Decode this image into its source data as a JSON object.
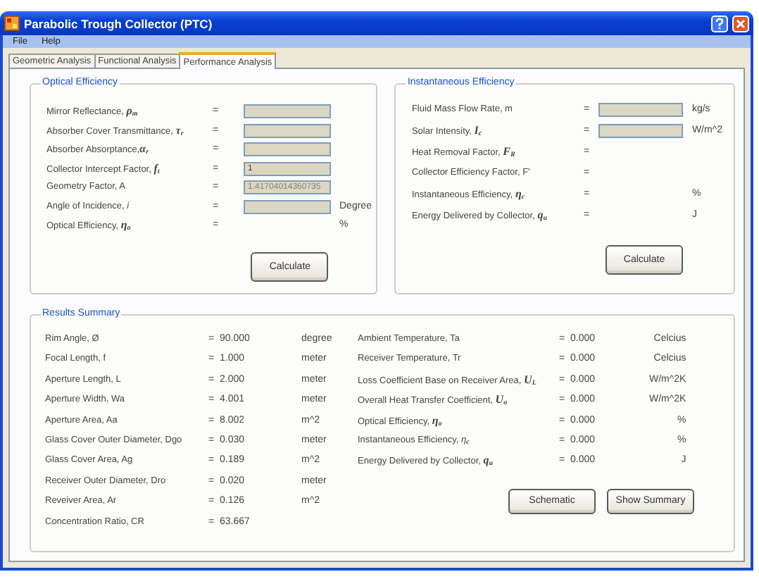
{
  "window": {
    "title": "Parabolic Trough Collector (PTC)"
  },
  "menu": [
    "File",
    "Help"
  ],
  "tabs": [
    {
      "label": "Geometric Analysis",
      "selected": false
    },
    {
      "label": "Functional Analysis",
      "selected": false
    },
    {
      "label": "Performance Analysis",
      "selected": true
    }
  ],
  "optical_efficiency": {
    "title": "Optical Efficiency",
    "button": "Calculate",
    "rows": [
      {
        "kind": "input",
        "label": "Mirror Reflectance, **ρ**$_{m}$",
        "sign": "="
      },
      {
        "kind": "input",
        "label": "Absorber Cover Transmittance, **τ**$_{r}$",
        "sign": "="
      },
      {
        "kind": "input",
        "label": "Absorber Absorptance,**α**$_{r}$",
        "sign": "="
      },
      {
        "kind": "input",
        "label": "Collector Intercept Factor, **f**$_{t}$",
        "sign": "=",
        "value": "1"
      },
      {
        "kind": "input",
        "label": "Geometry Factor, A",
        "sign": "=",
        "value": "1.41704014360735",
        "readonly": true
      },
      {
        "kind": "input",
        "label": "Angle of Incidence, *i*",
        "sign": "=",
        "unit": "Degree"
      },
      {
        "kind": "output",
        "label": "Optical Efficiency, **η**$_{o}$",
        "sign": "=",
        "unit": "%"
      }
    ]
  },
  "instantaneous_efficiency": {
    "title": "Instantaneous Efficiency",
    "button": "Calculate",
    "rows": [
      {
        "kind": "input",
        "label": "Fluid Mass Flow Rate, m",
        "sign": "=",
        "unit": "kg/s"
      },
      {
        "kind": "input",
        "label": "Solar Intensity, **I**$_{c}$",
        "sign": "=",
        "unit": "W/m^2"
      },
      {
        "kind": "output",
        "label": "Heat Removal Factor, **F**$_{R}$",
        "sign": "="
      },
      {
        "kind": "output",
        "label": "Collector Efficiency Factor, F'",
        "sign": "="
      },
      {
        "kind": "output",
        "label": "Instantaneous Efficiency, **η**$_{c}$",
        "sign": "=",
        "unit": "%"
      },
      {
        "kind": "output",
        "label": "Energy Delivered by Collector, **q**$_{u}$",
        "sign": "=",
        "unit": "J"
      }
    ]
  },
  "results_summary": {
    "title": "Results Summary",
    "buttons": [
      "Schematic",
      "Show Summary"
    ],
    "left_rows": [
      {
        "label": "Rim Angle, Ø",
        "sign": "=",
        "value": "90.000",
        "unit": "degree"
      },
      {
        "label": "Focal Length, f",
        "sign": "=",
        "value": "1.000",
        "unit": "meter"
      },
      {
        "label": "Aperture Length, L",
        "sign": "=",
        "value": "2.000",
        "unit": "meter"
      },
      {
        "label": "Aperture Width, Wa",
        "sign": "=",
        "value": "4.001",
        "unit": "meter"
      },
      {
        "label": "Aperture Area, Aa",
        "sign": "=",
        "value": "8.002",
        "unit": "m^2"
      },
      {
        "label": "Glass Cover Outer Diameter, Dgo",
        "sign": "=",
        "value": "0.030",
        "unit": "meter"
      },
      {
        "label": "Glass Cover Area, Ag",
        "sign": "=",
        "value": "0.189",
        "unit": "m^2"
      },
      {
        "label": "Receiver Outer Diameter, Dro",
        "sign": "=",
        "value": "0.020",
        "unit": "meter"
      },
      {
        "label": "Reveiver Area, Ar",
        "sign": "=",
        "value": "0.126",
        "unit": "m^2"
      },
      {
        "label": "Concentration Ratio, CR",
        "sign": "=",
        "value": "63.667"
      }
    ],
    "right_rows": [
      {
        "label": "Ambient Temperature, Ta",
        "sign": "=",
        "value": "0.000",
        "unit": "Celcius"
      },
      {
        "label": "Receiver Temperature, Tr",
        "sign": "=",
        "value": "0.000",
        "unit": "Celcius"
      },
      {
        "label": "Loss Coefficient Base on Receiver Area, **U**$_{L}$",
        "sign": "=",
        "value": "0.000",
        "unit": "W/m^2K"
      },
      {
        "label": "Overall Heat Transfer Coefficient, **U**$_{o}$",
        "sign": "=",
        "value": "0.000",
        "unit": "W/m^2K"
      },
      {
        "label": "Optical Efficiency, **η**$_{o}$",
        "sign": "=",
        "value": "0.000",
        "unit": "%"
      },
      {
        "label": "Instantaneous Efficiency, *η*$_{c}$",
        "sign": "=",
        "value": "0.000",
        "unit": "%"
      },
      {
        "label": "Energy Delivered by Collector, **q**$_{u}$",
        "sign": "=",
        "value": "0.000",
        "unit": "J"
      }
    ]
  }
}
